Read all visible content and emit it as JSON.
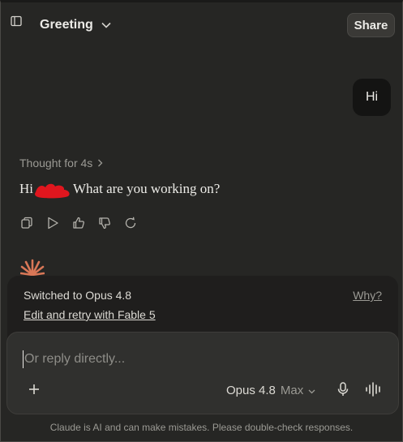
{
  "header": {
    "title": "Greeting",
    "share_label": "Share"
  },
  "messages": {
    "user_text": "Hi",
    "thought_label": "Thought for 4s",
    "reply_prefix": "Hi",
    "reply_suffix": "What are you working on?"
  },
  "notice": {
    "text": "Switched to Opus 4.8",
    "retry_link": "Edit and retry with Fable 5",
    "why_link": "Why?"
  },
  "composer": {
    "placeholder": "Or reply directly...",
    "model_name": "Opus 4.8",
    "model_mode": "Max"
  },
  "footer": {
    "disclaimer": "Claude is AI and can make mistakes. Please double-check responses."
  },
  "icons": {
    "sidebar": "sidebar-toggle-icon",
    "chevron": "chevron-down-icon",
    "copy": "copy-icon",
    "play": "play-icon",
    "thumbs_up": "thumbs-up-icon",
    "thumbs_down": "thumbs-down-icon",
    "retry": "retry-icon",
    "spark": "claude-spark-icon",
    "plus": "plus-icon",
    "mic": "microphone-icon",
    "voice": "voice-mode-icon"
  },
  "colors": {
    "background": "#262624",
    "composer": "#30302e",
    "accent": "#d97757",
    "redaction": "#e0161e"
  }
}
